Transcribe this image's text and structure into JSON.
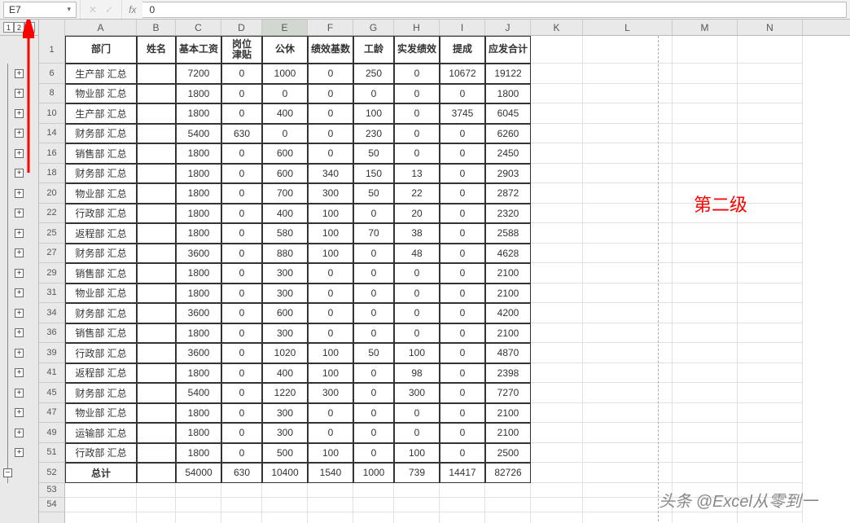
{
  "nameBox": "E7",
  "formulaValue": "0",
  "outlineLevels": [
    "1",
    "2",
    "3"
  ],
  "colLetters": [
    "A",
    "B",
    "C",
    "D",
    "E",
    "F",
    "G",
    "H",
    "I",
    "J",
    "K",
    "L",
    "M",
    "N"
  ],
  "headers": [
    "部门",
    "姓名",
    "基本工资",
    "岗位\n津贴",
    "公休",
    "绩效基数",
    "工龄",
    "实发绩效",
    "提成",
    "应发合计"
  ],
  "headerRowNum": "1",
  "rows": [
    {
      "rn": "6",
      "plus": true,
      "c": [
        "生产部 汇总",
        "",
        "7200",
        "0",
        "1000",
        "0",
        "250",
        "0",
        "10672",
        "19122"
      ],
      "selE": false
    },
    {
      "rn": "8",
      "plus": true,
      "c": [
        "物业部 汇总",
        "",
        "1800",
        "0",
        "0",
        "0",
        "0",
        "0",
        "0",
        "1800"
      ]
    },
    {
      "rn": "10",
      "plus": true,
      "c": [
        "生产部 汇总",
        "",
        "1800",
        "0",
        "400",
        "0",
        "100",
        "0",
        "3745",
        "6045"
      ]
    },
    {
      "rn": "14",
      "plus": true,
      "c": [
        "财务部 汇总",
        "",
        "5400",
        "630",
        "0",
        "0",
        "230",
        "0",
        "0",
        "6260"
      ]
    },
    {
      "rn": "16",
      "plus": true,
      "c": [
        "销售部 汇总",
        "",
        "1800",
        "0",
        "600",
        "0",
        "50",
        "0",
        "0",
        "2450"
      ]
    },
    {
      "rn": "18",
      "plus": true,
      "c": [
        "财务部 汇总",
        "",
        "1800",
        "0",
        "600",
        "340",
        "150",
        "13",
        "0",
        "2903"
      ]
    },
    {
      "rn": "20",
      "plus": true,
      "c": [
        "物业部 汇总",
        "",
        "1800",
        "0",
        "700",
        "300",
        "50",
        "22",
        "0",
        "2872"
      ]
    },
    {
      "rn": "22",
      "plus": true,
      "c": [
        "行政部 汇总",
        "",
        "1800",
        "0",
        "400",
        "100",
        "0",
        "20",
        "0",
        "2320"
      ]
    },
    {
      "rn": "25",
      "plus": true,
      "c": [
        "返程部 汇总",
        "",
        "1800",
        "0",
        "580",
        "100",
        "70",
        "38",
        "0",
        "2588"
      ]
    },
    {
      "rn": "27",
      "plus": true,
      "c": [
        "财务部 汇总",
        "",
        "3600",
        "0",
        "880",
        "100",
        "0",
        "48",
        "0",
        "4628"
      ]
    },
    {
      "rn": "29",
      "plus": true,
      "c": [
        "销售部 汇总",
        "",
        "1800",
        "0",
        "300",
        "0",
        "0",
        "0",
        "0",
        "2100"
      ]
    },
    {
      "rn": "31",
      "plus": true,
      "c": [
        "物业部 汇总",
        "",
        "1800",
        "0",
        "300",
        "0",
        "0",
        "0",
        "0",
        "2100"
      ]
    },
    {
      "rn": "34",
      "plus": true,
      "c": [
        "财务部 汇总",
        "",
        "3600",
        "0",
        "600",
        "0",
        "0",
        "0",
        "0",
        "4200"
      ]
    },
    {
      "rn": "36",
      "plus": true,
      "c": [
        "销售部 汇总",
        "",
        "1800",
        "0",
        "300",
        "0",
        "0",
        "0",
        "0",
        "2100"
      ]
    },
    {
      "rn": "39",
      "plus": true,
      "c": [
        "行政部 汇总",
        "",
        "3600",
        "0",
        "1020",
        "100",
        "50",
        "100",
        "0",
        "4870"
      ]
    },
    {
      "rn": "41",
      "plus": true,
      "c": [
        "返程部 汇总",
        "",
        "1800",
        "0",
        "400",
        "100",
        "0",
        "98",
        "0",
        "2398"
      ]
    },
    {
      "rn": "45",
      "plus": true,
      "c": [
        "财务部 汇总",
        "",
        "5400",
        "0",
        "1220",
        "300",
        "0",
        "300",
        "0",
        "7270"
      ]
    },
    {
      "rn": "47",
      "plus": true,
      "c": [
        "物业部 汇总",
        "",
        "1800",
        "0",
        "300",
        "0",
        "0",
        "0",
        "0",
        "2100"
      ]
    },
    {
      "rn": "49",
      "plus": true,
      "c": [
        "运输部 汇总",
        "",
        "1800",
        "0",
        "300",
        "0",
        "0",
        "0",
        "0",
        "2100"
      ]
    },
    {
      "rn": "51",
      "plus": true,
      "c": [
        "行政部 汇总",
        "",
        "1800",
        "0",
        "500",
        "100",
        "0",
        "100",
        "0",
        "2500"
      ]
    }
  ],
  "totalRow": {
    "rn": "52",
    "plus": false,
    "c": [
      "总计",
      "",
      "54000",
      "630",
      "10400",
      "1540",
      "1000",
      "739",
      "14417",
      "82726"
    ]
  },
  "emptyRows": [
    "53",
    "54",
    ""
  ],
  "annotation": "第二级",
  "watermark": "头条 @Excel从零到一",
  "icons": {
    "cancel": "✕",
    "confirm": "✓",
    "dropdown": "▾",
    "plus": "+",
    "minus": "−"
  }
}
